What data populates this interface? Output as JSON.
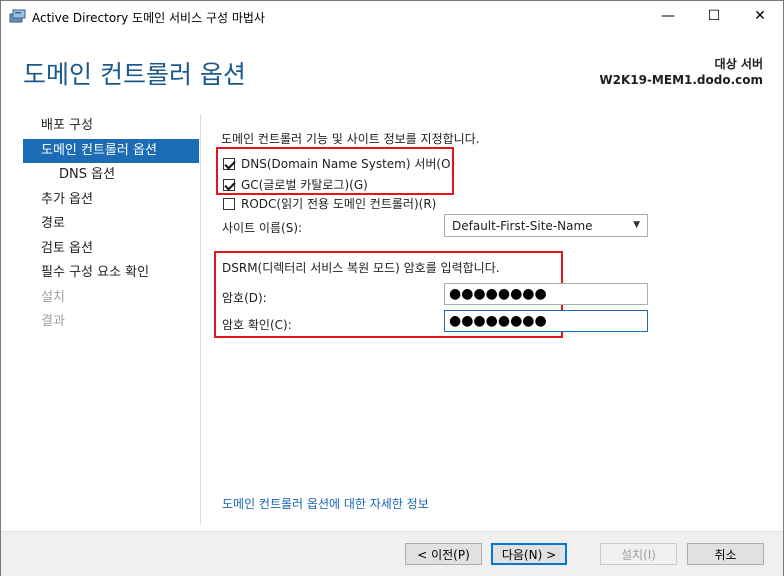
{
  "window": {
    "title": "Active Directory 도메인 서비스 구성 마법사",
    "controls": {
      "minimize": "—",
      "maximize": "☐",
      "close": "✕"
    },
    "app_icon": "server-icon"
  },
  "header": {
    "page_title": "도메인 컨트롤러 옵션",
    "target_label": "대상 서버",
    "target_server": "W2K19-MEM1.dodo.com"
  },
  "sidebar": {
    "items": [
      {
        "label": "배포 구성",
        "state": "normal"
      },
      {
        "label": "도메인 컨트롤러 옵션",
        "state": "active"
      },
      {
        "label": "DNS 옵션",
        "state": "sub"
      },
      {
        "label": "추가 옵션",
        "state": "normal"
      },
      {
        "label": "경로",
        "state": "normal"
      },
      {
        "label": "검토 옵션",
        "state": "normal"
      },
      {
        "label": "필수 구성 요소 확인",
        "state": "normal"
      },
      {
        "label": "설치",
        "state": "disabled"
      },
      {
        "label": "결과",
        "state": "disabled"
      }
    ]
  },
  "main": {
    "description": "도메인 컨트롤러 기능 및 사이트 정보를 지정합니다.",
    "options": {
      "dns": {
        "label": "DNS(Domain Name System) 서버(O)",
        "checked": true
      },
      "gc": {
        "label": "GC(글로벌 카탈로그)(G)",
        "checked": true
      },
      "rodc": {
        "label": "RODC(읽기 전용 도메인 컨트롤러)(R)",
        "checked": false
      }
    },
    "site": {
      "label": "사이트 이름(S):",
      "value": "Default-First-Site-Name"
    },
    "dsrm": {
      "description": "DSRM(디렉터리 서비스 복원 모드) 암호를 입력합니다.",
      "password_label": "암호(D):",
      "password_value": "●●●●●●●●",
      "confirm_label": "암호 확인(C):",
      "confirm_value": "●●●●●●●●"
    },
    "more_link": "도메인 컨트롤러 옵션에 대한 자세한 정보"
  },
  "footer": {
    "prev": "< 이전(P)",
    "next": "다음(N) >",
    "install": "설치(I)",
    "cancel": "취소"
  },
  "colors": {
    "accent": "#1b6bb5",
    "title_blue": "#1c5a8e",
    "highlight_red": "#e3141c",
    "link": "#1565b8"
  }
}
